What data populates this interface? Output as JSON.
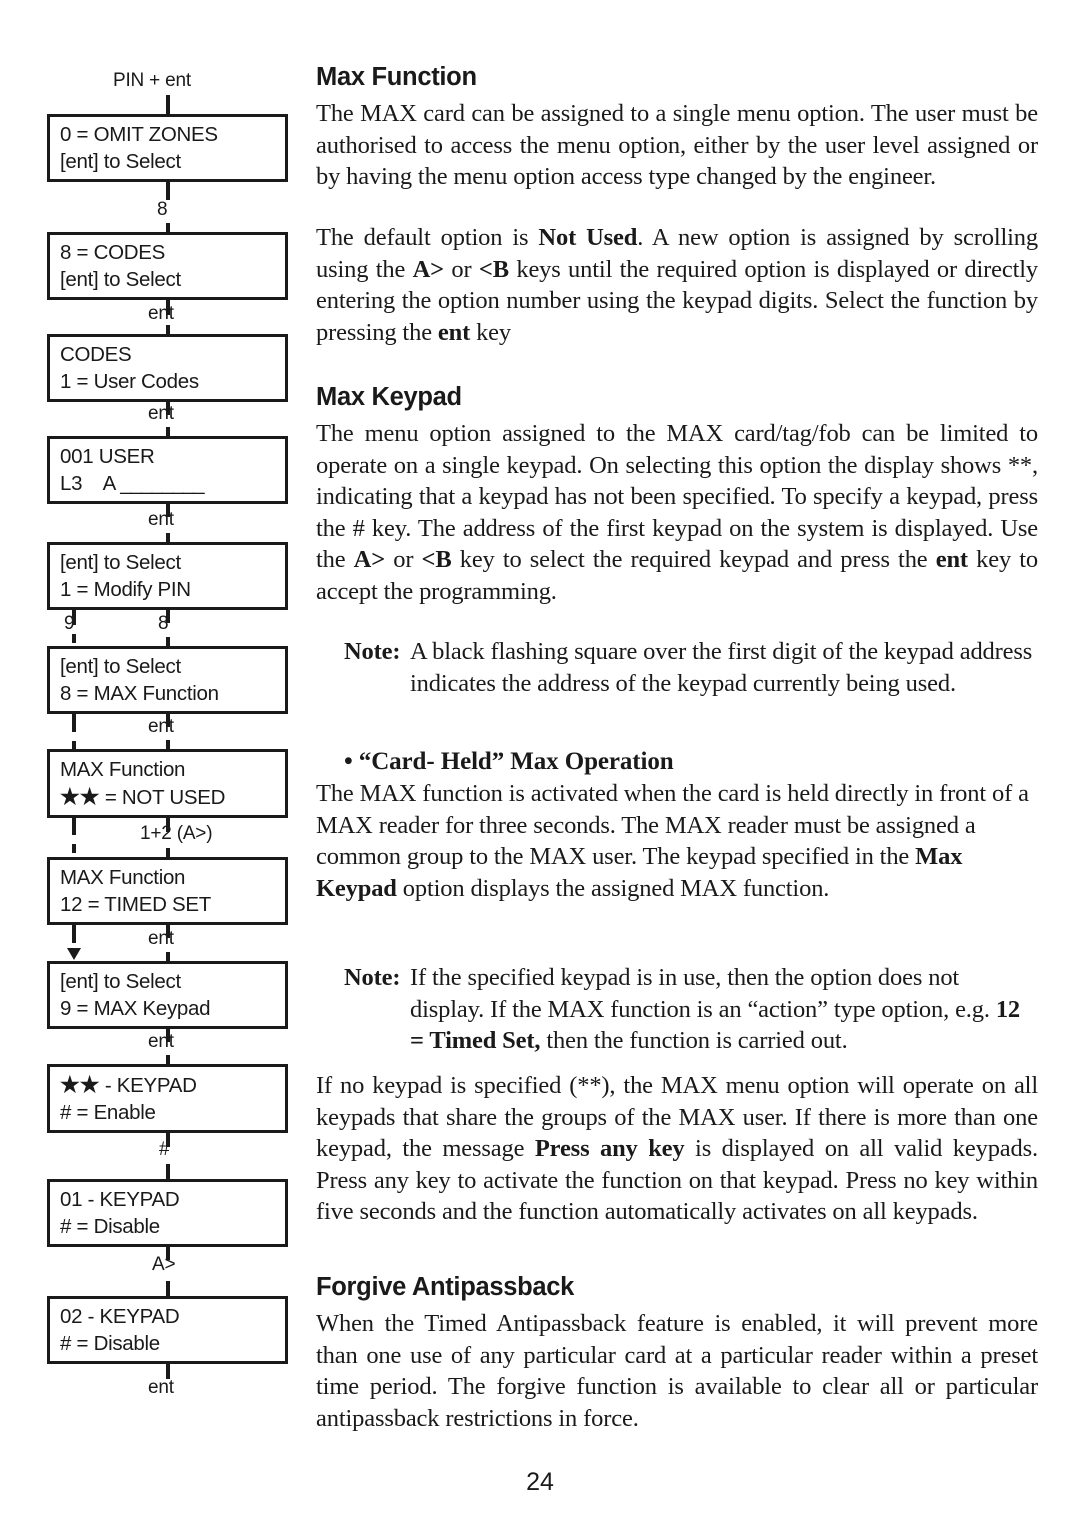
{
  "page": {
    "number": "24"
  },
  "flowchart": {
    "entry_label": "PIN + ent",
    "boxes": [
      {
        "line1": "0 = OMIT ZONES",
        "line2": "[ent] to Select"
      },
      {
        "line1": "8 = CODES",
        "line2": "[ent] to Select"
      },
      {
        "line1": "CODES",
        "line2": "1 = User Codes"
      },
      {
        "line1": "001 USER",
        "line2_a": "L3    A ",
        "line2_b": "________"
      },
      {
        "line1": "[ent] to Select",
        "line2": "1 = Modify PIN"
      },
      {
        "line1": "[ent] to Select",
        "line2": "8 = MAX Function"
      },
      {
        "line1": "MAX Function",
        "line2_stars": "★★",
        "line2_rest": " = NOT USED"
      },
      {
        "line1": "MAX Function",
        "line2": "12 = TIMED SET"
      },
      {
        "line1": "[ent] to Select",
        "line2": "9 = MAX Keypad"
      },
      {
        "line1_stars": "★★",
        "line1_rest": " - KEYPAD",
        "line2": "# = Enable"
      },
      {
        "line1": "01 - KEYPAD",
        "line2": "# = Disable"
      },
      {
        "line1": "02 - KEYPAD",
        "line2": "# = Disable"
      }
    ],
    "connector_labels": {
      "c1": "8",
      "c2": "ent",
      "c3": "ent",
      "c4": "ent",
      "c5_solid": "8",
      "c5_dashed": "9",
      "c6": "ent",
      "c7": "1+2 (A>)",
      "c8": "ent",
      "c9": "ent",
      "c10": "#",
      "c11": "A>",
      "c12": "ent"
    }
  },
  "content": {
    "max_function": {
      "heading": "Max Function",
      "p1": "The MAX card can be assigned to a single menu option. The user must be authorised to access the menu option, either by the user level assigned or by having the menu option access type changed by the engineer.",
      "p2_a": "The default option is ",
      "p2_b": "Not Used",
      "p2_c": ".  A new option is assigned by scrolling using the ",
      "p2_d": "A>",
      "p2_e": " or ",
      "p2_f": "<B",
      "p2_g": " keys until the required option is displayed or directly entering the option number using the keypad digits. Select the function by pressing the ",
      "p2_h": "ent",
      "p2_i": " key"
    },
    "max_keypad": {
      "heading": "Max Keypad",
      "p1_a": "The menu option assigned to the MAX card/tag/fob can be limited to operate on a single keypad. On selecting this option the display shows **, indicating that a keypad has not been specified. To specify a keypad, press the # key. The address of the first keypad on the system is displayed. Use the ",
      "p1_b": "A>",
      "p1_c": " or ",
      "p1_d": "<B",
      "p1_e": " key to select the required keypad and press the ",
      "p1_f": "ent",
      "p1_g": " key to accept the programming.",
      "note1_tag": "Note:",
      "note1_text": "A black flashing square over the first digit of the keypad address indicates the address of the keypad currently being used."
    },
    "card_held": {
      "bullet_heading": "• “Card- Held” Max Operation",
      "p1_a": "The MAX function is activated when the card is held directly in front of a MAX reader for three seconds. The MAX reader must be assigned a common group to the MAX user. The keypad specified in the ",
      "p1_b": "Max Keypad",
      "p1_c": " option displays the assigned MAX function.",
      "note2_tag": "Note:",
      "note2_a": "If the specified keypad is in use, then the option does not display. If the MAX function is an “action” type option, e.g. ",
      "note2_b": "12 = Timed Set,",
      "note2_c": " then the function is carried out.",
      "p2_a": "If no keypad is specified (**), the MAX menu option will operate on all keypads that share the groups of the MAX user. If there is more than one keypad, the message ",
      "p2_b": "Press any key",
      "p2_c": " is displayed on all valid keypads. Press any key to activate the function on that keypad. Press no key within five seconds and the function automatically activates on all keypads."
    },
    "forgive": {
      "heading": "Forgive Antipassback",
      "p1": "When the Timed Antipassback feature is enabled, it will prevent more than one use of any particular card at a particular reader within a preset time period. The forgive function is available to clear all or particular antipassback restrictions in force."
    }
  }
}
